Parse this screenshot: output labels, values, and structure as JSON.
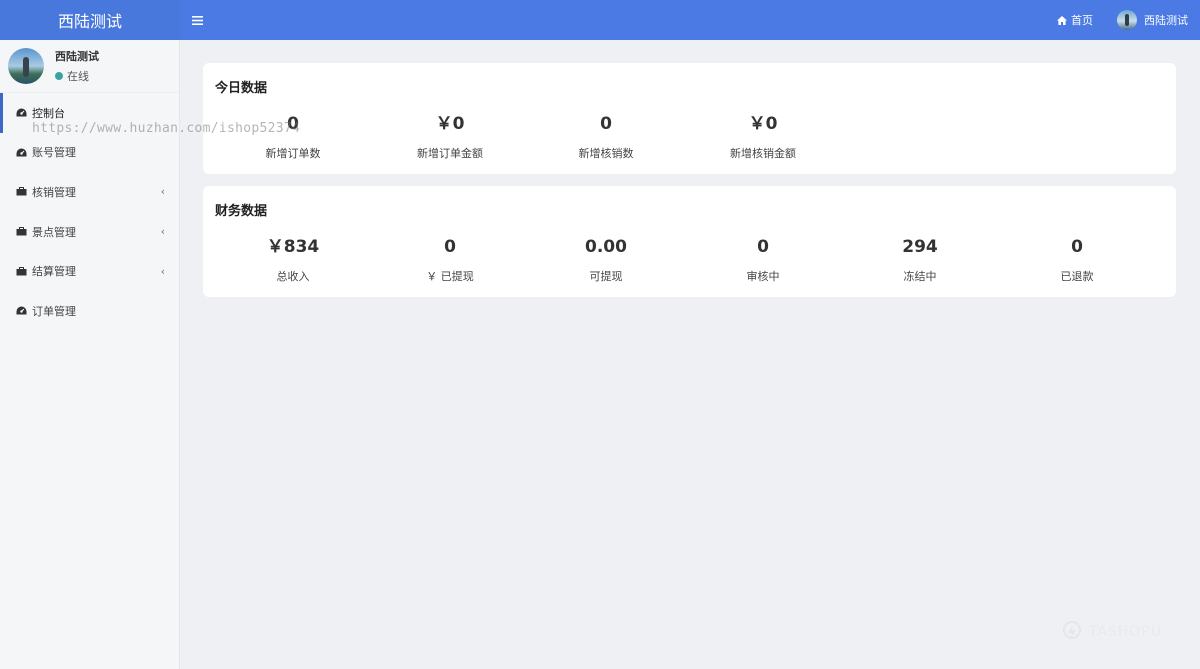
{
  "brand": {
    "title": "西陆测试"
  },
  "topbar": {
    "home_label": "首页",
    "user_name": "西陆测试"
  },
  "sidebar": {
    "user": {
      "name": "西陆测试",
      "status": "在线"
    },
    "items": [
      {
        "label": "控制台",
        "icon": "dashboard-icon",
        "active": true,
        "expandable": false
      },
      {
        "label": "账号管理",
        "icon": "dashboard-icon",
        "active": false,
        "expandable": false
      },
      {
        "label": "核销管理",
        "icon": "folder-icon",
        "active": false,
        "expandable": true
      },
      {
        "label": "景点管理",
        "icon": "folder-icon",
        "active": false,
        "expandable": true
      },
      {
        "label": "结算管理",
        "icon": "folder-icon",
        "active": false,
        "expandable": true
      },
      {
        "label": "订单管理",
        "icon": "dashboard-icon",
        "active": false,
        "expandable": false
      }
    ]
  },
  "today": {
    "title": "今日数据",
    "stats": [
      {
        "value": "0",
        "label": "新增订单数"
      },
      {
        "value": "￥0",
        "label": "新增订单金额"
      },
      {
        "value": "0",
        "label": "新增核销数"
      },
      {
        "value": "￥0",
        "label": "新增核销金额"
      }
    ]
  },
  "finance": {
    "title": "财务数据",
    "stats": [
      {
        "value": "￥834",
        "label": "总收入"
      },
      {
        "value": "0",
        "label": "￥ 已提现"
      },
      {
        "value": "0.00",
        "label": "可提现"
      },
      {
        "value": "0",
        "label": "审核中"
      },
      {
        "value": "294",
        "label": "冻结中"
      },
      {
        "value": "0",
        "label": "已退款"
      }
    ]
  },
  "overlay": {
    "watermark": "https://www.huzhan.com/ishop52374",
    "corner_logo": "TASHOPU"
  },
  "colors": {
    "accent": "#4b7ae4",
    "brand_bg": "#4878dc",
    "status_online": "#3aa3a0",
    "page_bg": "#eef0f4"
  }
}
